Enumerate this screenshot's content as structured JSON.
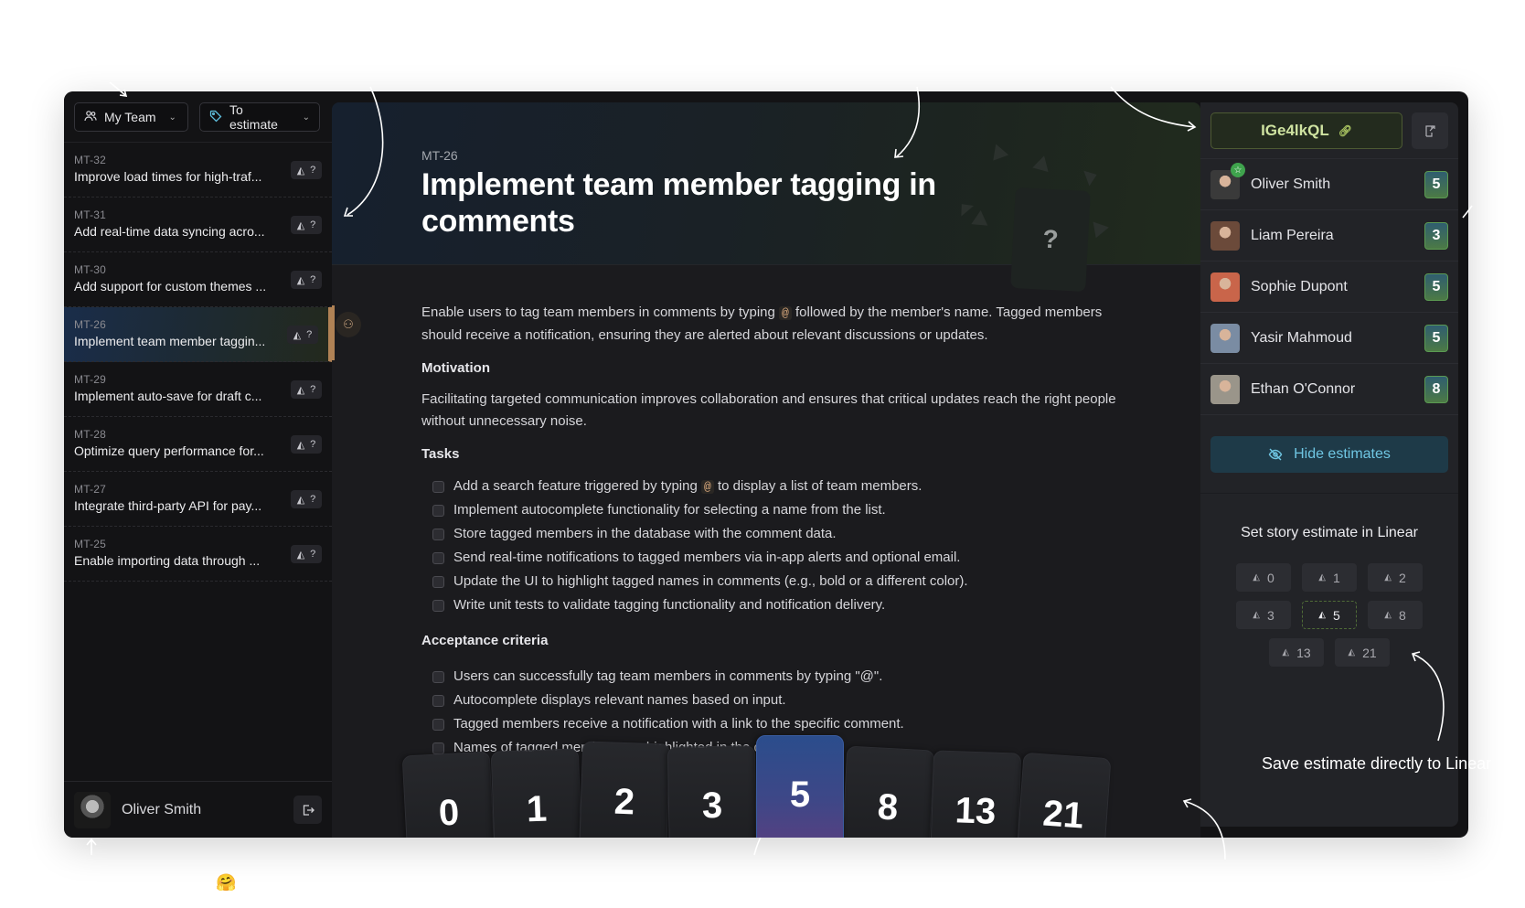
{
  "filters": {
    "team": {
      "label": "My Team",
      "icon": "users-icon"
    },
    "status": {
      "label": "To estimate",
      "icon": "tag-icon"
    }
  },
  "issues": [
    {
      "id": "MT-32",
      "title": "Improve load times for high-traf...",
      "estimate": "?"
    },
    {
      "id": "MT-31",
      "title": "Add real-time data syncing acro...",
      "estimate": "?"
    },
    {
      "id": "MT-30",
      "title": "Add support for custom themes ...",
      "estimate": "?"
    },
    {
      "id": "MT-26",
      "title": "Implement team member taggin...",
      "estimate": "?",
      "active": true
    },
    {
      "id": "MT-29",
      "title": "Implement auto-save for draft c...",
      "estimate": "?"
    },
    {
      "id": "MT-28",
      "title": "Optimize query performance for...",
      "estimate": "?"
    },
    {
      "id": "MT-27",
      "title": "Integrate third-party API for pay...",
      "estimate": "?"
    },
    {
      "id": "MT-25",
      "title": "Enable importing data through ...",
      "estimate": "?"
    }
  ],
  "current_user": {
    "name": "Oliver Smith"
  },
  "issue": {
    "id": "MT-26",
    "title": "Implement team member tagging in comments",
    "hero_card": "?",
    "description_before": "Enable users to tag team members in comments by typing",
    "description_code": "@",
    "description_after": "followed by the member's name. Tagged members should receive a notification, ensuring they are alerted about relevant discussions or updates.",
    "motivation_heading": "Motivation",
    "motivation": "Facilitating targeted communication improves collaboration and ensures that critical updates reach the right people without unnecessary noise.",
    "tasks_heading": "Tasks",
    "task_first_before": "Add a search feature triggered by typing",
    "task_first_code": "@",
    "task_first_after": "to display a list of team members.",
    "tasks": [
      "Implement autocomplete functionality for selecting a name from the list.",
      "Store tagged members in the database with the comment data.",
      "Send real-time notifications to tagged members via in-app alerts and optional email.",
      "Update the UI to highlight tagged names in comments (e.g., bold or a different color).",
      "Write unit tests to validate tagging functionality and notification delivery."
    ],
    "acceptance_heading": "Acceptance criteria",
    "acceptance": [
      "Users can successfully tag team members in comments by typing \"@\".",
      "Autocomplete displays relevant names based on input.",
      "Tagged members receive a notification with a link to the specific comment.",
      "Names of tagged members are highlighted in the comment."
    ]
  },
  "cards": [
    "0",
    "1",
    "2",
    "3",
    "5",
    "8",
    "13",
    "21"
  ],
  "selected_card": "5",
  "room": {
    "code": "IGe4lkQL"
  },
  "players": [
    {
      "name": "Oliver Smith",
      "vote": "5",
      "host": true,
      "color": "#3a3a3a"
    },
    {
      "name": "Liam Pereira",
      "vote": "3",
      "color": "#6b4a3a"
    },
    {
      "name": "Sophie Dupont",
      "vote": "5",
      "color": "#c9654a"
    },
    {
      "name": "Yasir Mahmoud",
      "vote": "5",
      "color": "#7a8ca3"
    },
    {
      "name": "Ethan O'Connor",
      "vote": "8",
      "color": "#9a958a"
    }
  ],
  "hide_estimates_label": "Hide estimates",
  "set_estimate_title": "Set story estimate in Linear",
  "estimate_options": [
    "0",
    "1",
    "2",
    "3",
    "5",
    "8",
    "13",
    "21"
  ],
  "current_estimate": "5",
  "annotations": {
    "save_note": "Save estimate directly to Linear"
  },
  "emoji": "🤗",
  "colors": {
    "accent_blue": "#6fc6e3",
    "vote_green": "#5b9a52",
    "room_green": "#cfe3a1",
    "active_marker": "#b08255"
  }
}
